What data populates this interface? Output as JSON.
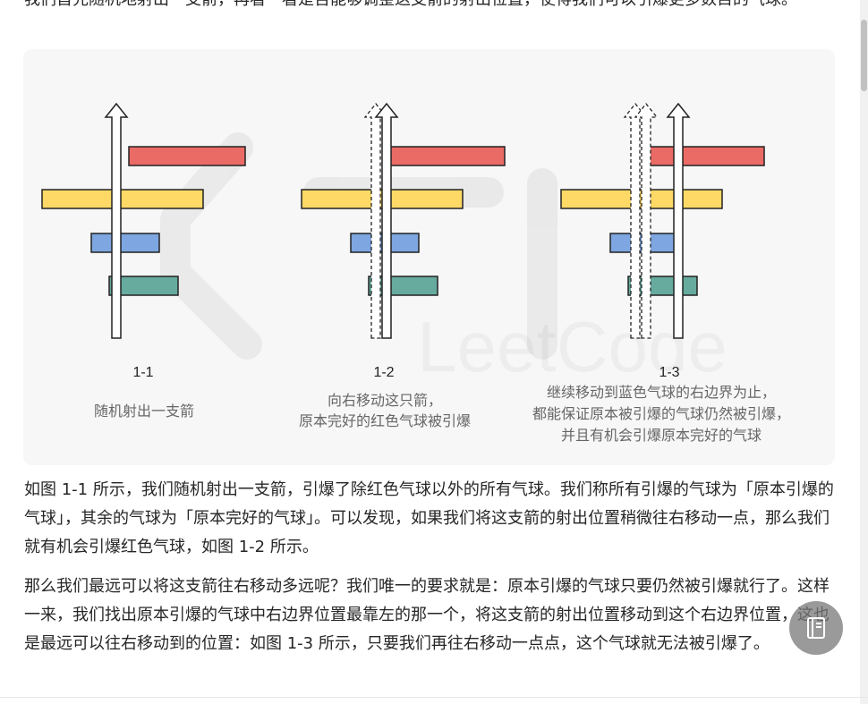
{
  "intro_text": "我们首先随机地射出一支箭，再看一看是否能够调整这支箭的射出位置，使得我们可以引爆更多数目的气球。",
  "figure": {
    "watermark": "LeetCode",
    "panels": [
      {
        "label": "1-1",
        "caption_lines": [
          "随机射出一支箭"
        ]
      },
      {
        "label": "1-2",
        "caption_lines": [
          "向右移动这只箭，",
          "原本完好的红色气球被引爆"
        ]
      },
      {
        "label": "1-3",
        "caption_lines": [
          "继续移动到蓝色气球的右边界为止，",
          "都能保证原本被引爆的气球仍然被引爆，",
          "并且有机会引爆原本完好的气球"
        ]
      }
    ],
    "colors": {
      "red": "#ea6b66",
      "yellow": "#ffd966",
      "blue": "#7ea6e0",
      "green": "#67ab9f"
    }
  },
  "paragraphs": [
    "如图 1-1 所示，我们随机射出一支箭，引爆了除红色气球以外的所有气球。我们称所有引爆的气球为「原本引爆的气球」，其余的气球为「原本完好的气球」。可以发现，如果我们将这支箭的射出位置稍微往右移动一点，那么我们就有机会引爆红色气球，如图 1-2 所示。",
    "那么我们最远可以将这支箭往右移动多远呢？我们唯一的要求就是：原本引爆的气球只要仍然被引爆就行了。这样一来，我们找出原本引爆的气球中右边界位置最靠左的那一个，将这支箭的射出位置移动到这个右边界位置，这也是最远可以往右移动到的位置：如图 1-3 所示，只要我们再往右移动一点点，这个气球就无法被引爆了。"
  ],
  "icons": {
    "float_button": "document-icon"
  }
}
